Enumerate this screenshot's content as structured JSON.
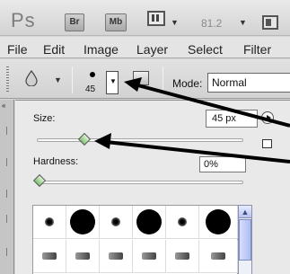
{
  "appbar": {
    "logo": "Ps",
    "bridge_label": "Br",
    "minibridge_label": "Mb",
    "zoom": "81.2",
    "dropdown_glyph": "▼"
  },
  "menu": {
    "items": [
      "File",
      "Edit",
      "Image",
      "Layer",
      "Select",
      "Filter"
    ]
  },
  "options": {
    "tool_icon": "blur-drop-icon",
    "brush_size": "45",
    "mode_label": "Mode:",
    "mode_value": "Normal",
    "dropdown_glyph": "▼"
  },
  "brush_picker": {
    "size_label": "Size:",
    "size_value": "45 px",
    "size_fraction": 0.22,
    "hardness_label": "Hardness:",
    "hardness_value": "0%",
    "hardness_fraction": 0.0,
    "presets_row1": [
      {
        "kind": "soft",
        "size": "small"
      },
      {
        "kind": "hard",
        "size": "large"
      },
      {
        "kind": "soft",
        "size": "small"
      },
      {
        "kind": "hard",
        "size": "large"
      },
      {
        "kind": "soft",
        "size": "small"
      },
      {
        "kind": "hard",
        "size": "large"
      }
    ],
    "presets_row2_icons": [
      "brush-tip-icon",
      "brush-tip-icon",
      "brush-tip-icon",
      "brush-tip-icon",
      "brush-tip-icon",
      "brush-tip-icon"
    ]
  },
  "colors": {
    "thumb": "#7ec36d",
    "arrow": "#000000",
    "scrollbar": "#aebdf0"
  }
}
